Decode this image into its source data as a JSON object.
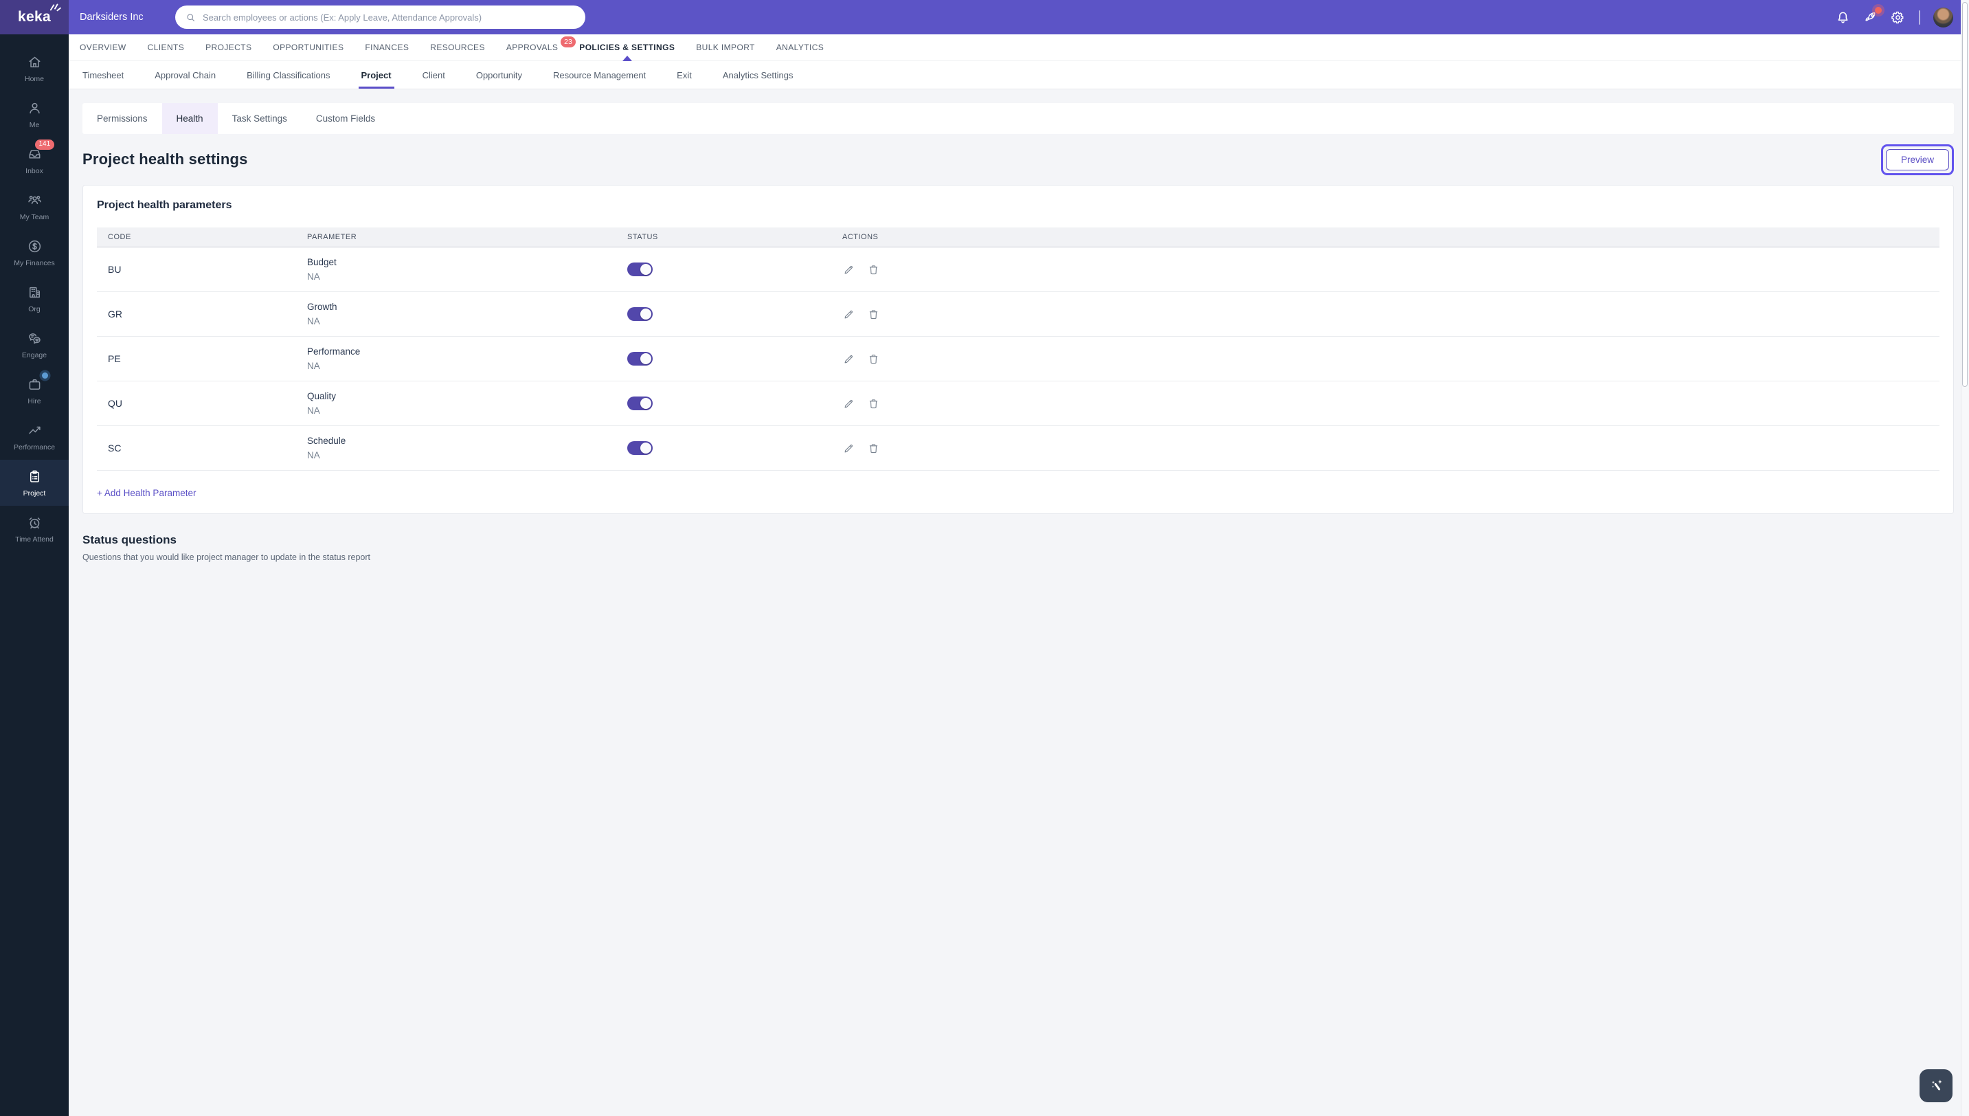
{
  "brand": {
    "logo_text": "keka",
    "company": "Darksiders Inc"
  },
  "search": {
    "placeholder": "Search employees or actions (Ex: Apply Leave, Attendance Approvals)"
  },
  "header": {
    "icons": [
      "bell-icon",
      "rocket-icon",
      "gear-icon",
      "user-avatar"
    ]
  },
  "nav": {
    "items": [
      {
        "label": "OVERVIEW"
      },
      {
        "label": "CLIENTS"
      },
      {
        "label": "PROJECTS"
      },
      {
        "label": "OPPORTUNITIES"
      },
      {
        "label": "FINANCES"
      },
      {
        "label": "RESOURCES"
      },
      {
        "label": "APPROVALS",
        "badge": "23"
      },
      {
        "label": "POLICIES & SETTINGS",
        "active": true
      },
      {
        "label": "BULK IMPORT"
      },
      {
        "label": "ANALYTICS"
      }
    ]
  },
  "subnav": {
    "items": [
      {
        "label": "Timesheet"
      },
      {
        "label": "Approval Chain"
      },
      {
        "label": "Billing Classifications"
      },
      {
        "label": "Project",
        "active": true
      },
      {
        "label": "Client"
      },
      {
        "label": "Opportunity"
      },
      {
        "label": "Resource Management"
      },
      {
        "label": "Exit"
      },
      {
        "label": "Analytics Settings"
      }
    ]
  },
  "tabs": {
    "items": [
      {
        "label": "Permissions"
      },
      {
        "label": "Health",
        "active": true
      },
      {
        "label": "Task Settings"
      },
      {
        "label": "Custom Fields"
      }
    ]
  },
  "sidebar": {
    "items": [
      {
        "label": "Home",
        "icon": "home"
      },
      {
        "label": "Me",
        "icon": "me"
      },
      {
        "label": "Inbox",
        "icon": "inbox",
        "badge": "141"
      },
      {
        "label": "My Team",
        "icon": "team"
      },
      {
        "label": "My Finances",
        "icon": "finances"
      },
      {
        "label": "Org",
        "icon": "org"
      },
      {
        "label": "Engage",
        "icon": "engage"
      },
      {
        "label": "Hire",
        "icon": "hire",
        "dot": true
      },
      {
        "label": "Performance",
        "icon": "performance"
      },
      {
        "label": "Project",
        "icon": "project",
        "active": true
      },
      {
        "label": "Time Attend",
        "icon": "time"
      }
    ]
  },
  "page": {
    "title": "Project health settings",
    "preview_label": "Preview"
  },
  "parameters_card": {
    "title": "Project health parameters",
    "columns": [
      "CODE",
      "PARAMETER",
      "STATUS",
      "ACTIONS"
    ],
    "rows": [
      {
        "code": "BU",
        "parameter": "Budget",
        "value": "NA",
        "enabled": true,
        "label": "Budget"
      },
      {
        "code": "GR",
        "parameter": "Growth",
        "value": "NA",
        "enabled": true,
        "label": "Growth"
      },
      {
        "code": "PE",
        "parameter": "Performance",
        "value": "NA",
        "enabled": true,
        "label": "Performance"
      },
      {
        "code": "QU",
        "parameter": "Quality",
        "value": "NA",
        "enabled": true,
        "label": "Quality"
      },
      {
        "code": "SC",
        "parameter": "Schedule",
        "value": "NA",
        "enabled": true,
        "label": "Schedule"
      }
    ],
    "add_label": "+ Add Health Parameter"
  },
  "status_questions": {
    "title": "Status questions",
    "subtitle": "Questions that you would like project manager to update in the status report"
  },
  "colors": {
    "header_purple": "#5c54c6",
    "logo_purple": "#453b87",
    "sidebar_navy": "#15202e",
    "accent": "#5b4ec9",
    "toggle_on": "#5247ab",
    "badge_red": "#ee6b70",
    "annotation_purple": "#6254ee"
  }
}
